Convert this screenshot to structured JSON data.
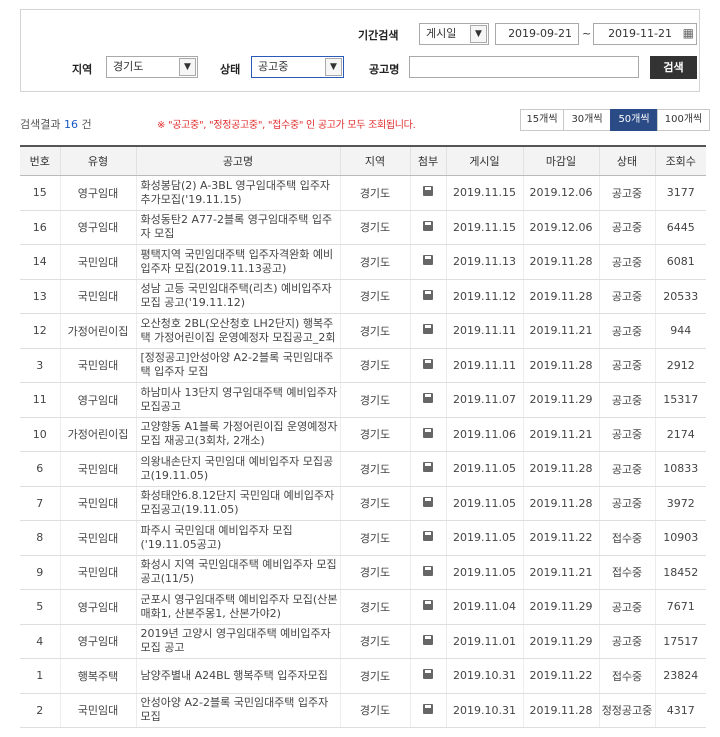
{
  "search": {
    "period_label": "기간검색",
    "date_type": "게시일",
    "date_from": "2019-09-21",
    "date_sep": "~",
    "date_to": "2019-11-21",
    "region_label": "지역",
    "region_value": "경기도",
    "status_label": "상태",
    "status_value": "공고중",
    "name_label": "공고명",
    "name_value": "",
    "search_button": "검색"
  },
  "result": {
    "prefix": "검색결과",
    "count": "16",
    "suffix": "건",
    "notice": "※ \"공고중\", \"정정공고중\", \"접수중\" 인 공고가 모두 조회됩니다."
  },
  "page_size": {
    "options": [
      "15개씩",
      "30개씩",
      "50개씩",
      "100개씩"
    ],
    "selected": "50개씩"
  },
  "table": {
    "headers": [
      "번호",
      "유형",
      "공고명",
      "지역",
      "첨부",
      "게시일",
      "마감일",
      "상태",
      "조회수"
    ],
    "rows": [
      {
        "no": "15",
        "type": "영구임대",
        "title": "화성봉담(2) A-3BL 영구임대주택 입주자 추가모집('19.11.15)",
        "region": "경기도",
        "posted": "2019.11.15",
        "deadline": "2019.12.06",
        "status": "공고중",
        "views": "3177"
      },
      {
        "no": "16",
        "type": "영구임대",
        "title": "화성동탄2 A77-2블록 영구임대주택 입주자 모집",
        "region": "경기도",
        "posted": "2019.11.15",
        "deadline": "2019.12.06",
        "status": "공고중",
        "views": "6445"
      },
      {
        "no": "14",
        "type": "국민임대",
        "title": "평택지역 국민임대주택 입주자격완화 예비입주자 모집(2019.11.13공고)",
        "region": "경기도",
        "posted": "2019.11.13",
        "deadline": "2019.11.28",
        "status": "공고중",
        "views": "6081"
      },
      {
        "no": "13",
        "type": "국민임대",
        "title": "성남 고등 국민임대주택(리츠) 예비입주자 모집 공고('19.11.12)",
        "region": "경기도",
        "posted": "2019.11.12",
        "deadline": "2019.11.28",
        "status": "공고중",
        "views": "20533"
      },
      {
        "no": "12",
        "type": "가정어린이집",
        "title": "오산청호 2BL(오산청호 LH2단지) 행복주택 가정어린이집 운영예정자 모집공고_2회",
        "region": "경기도",
        "posted": "2019.11.11",
        "deadline": "2019.11.21",
        "status": "공고중",
        "views": "944"
      },
      {
        "no": "3",
        "type": "국민임대",
        "title": "[정정공고]안성아양 A2-2블록 국민임대주택 입주자 모집",
        "region": "경기도",
        "posted": "2019.11.11",
        "deadline": "2019.11.28",
        "status": "공고중",
        "views": "2912"
      },
      {
        "no": "11",
        "type": "영구임대",
        "title": "하남미사 13단지 영구임대주택 예비입주자 모집공고",
        "region": "경기도",
        "posted": "2019.11.07",
        "deadline": "2019.11.29",
        "status": "공고중",
        "views": "15317"
      },
      {
        "no": "10",
        "type": "가정어린이집",
        "title": "고양향동 A1블록 가정어린이집 운영예정자 모집 재공고(3회차, 2개소)",
        "region": "경기도",
        "posted": "2019.11.06",
        "deadline": "2019.11.21",
        "status": "공고중",
        "views": "2174"
      },
      {
        "no": "6",
        "type": "국민임대",
        "title": "의왕내손단지 국민임대 예비입주자 모집공고(19.11.05)",
        "region": "경기도",
        "posted": "2019.11.05",
        "deadline": "2019.11.28",
        "status": "공고중",
        "views": "10833"
      },
      {
        "no": "7",
        "type": "국민임대",
        "title": "화성태안6.8.12단지 국민임대 예비입주자 모집공고(19.11.05)",
        "region": "경기도",
        "posted": "2019.11.05",
        "deadline": "2019.11.28",
        "status": "공고중",
        "views": "3972"
      },
      {
        "no": "8",
        "type": "국민임대",
        "title": "파주시 국민임대 예비입주자 모집('19.11.05공고)",
        "region": "경기도",
        "posted": "2019.11.05",
        "deadline": "2019.11.22",
        "status": "접수중",
        "views": "10903"
      },
      {
        "no": "9",
        "type": "국민임대",
        "title": "화성시 지역 국민임대주택 예비입주자 모집공고(11/5)",
        "region": "경기도",
        "posted": "2019.11.05",
        "deadline": "2019.11.21",
        "status": "접수중",
        "views": "18452"
      },
      {
        "no": "5",
        "type": "영구임대",
        "title": "군포시 영구임대주택 예비입주자 모집(산본매화1, 산본주몽1, 산본가야2)",
        "region": "경기도",
        "posted": "2019.11.04",
        "deadline": "2019.11.29",
        "status": "공고중",
        "views": "7671"
      },
      {
        "no": "4",
        "type": "영구임대",
        "title": "2019년 고양시 영구임대주택 예비입주자 모집 공고",
        "region": "경기도",
        "posted": "2019.11.01",
        "deadline": "2019.11.29",
        "status": "공고중",
        "views": "17517"
      },
      {
        "no": "1",
        "type": "행복주택",
        "title": "남양주별내 A24BL 행복주택 입주자모집",
        "region": "경기도",
        "posted": "2019.10.31",
        "deadline": "2019.11.22",
        "status": "접수중",
        "views": "23824"
      },
      {
        "no": "2",
        "type": "국민임대",
        "title": "안성아양 A2-2블록 국민임대주택 입주자 모집",
        "region": "경기도",
        "posted": "2019.10.31",
        "deadline": "2019.11.28",
        "status": "정정공고중",
        "views": "4317"
      }
    ]
  },
  "icons": {
    "attachment": "floppy-disk-icon",
    "calendar": "calendar-icon",
    "dropdown": "chevron-down-icon"
  }
}
